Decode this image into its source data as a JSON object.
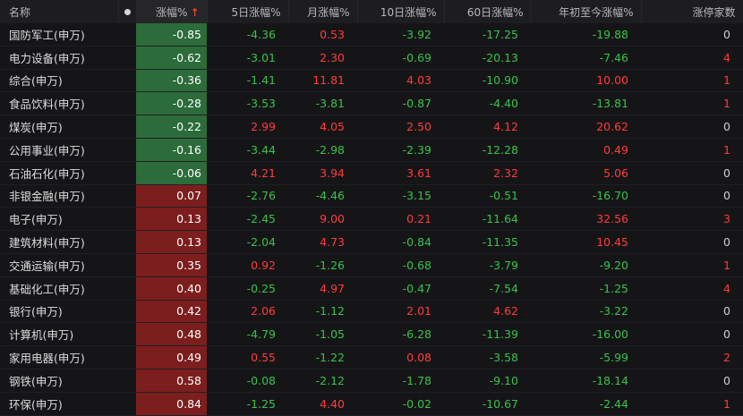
{
  "headers": {
    "name": "名称",
    "change": "涨幅%",
    "sort_arrow": "↑",
    "chg5": "5日涨幅%",
    "chg_month": "月涨幅%",
    "chg10": "10日涨幅%",
    "chg60": "60日涨幅%",
    "chg_ytd": "年初至今涨幅%",
    "limit_up": "涨停家数"
  },
  "colors": {
    "up": "#ff3b3b",
    "down": "#39c24a",
    "bg_up": "#7d1e1e",
    "bg_down": "#2c6b3a"
  },
  "rows": [
    {
      "name": "国防军工(申万)",
      "change": "-0.85",
      "chg5": "-4.36",
      "chg_month": "0.53",
      "chg10": "-3.92",
      "chg60": "-17.25",
      "chg_ytd": "-19.88",
      "limit_up": "0"
    },
    {
      "name": "电力设备(申万)",
      "change": "-0.62",
      "chg5": "-3.01",
      "chg_month": "2.30",
      "chg10": "-0.69",
      "chg60": "-20.13",
      "chg_ytd": "-7.46",
      "limit_up": "4"
    },
    {
      "name": "综合(申万)",
      "change": "-0.36",
      "chg5": "-1.41",
      "chg_month": "11.81",
      "chg10": "4.03",
      "chg60": "-10.90",
      "chg_ytd": "10.00",
      "limit_up": "1"
    },
    {
      "name": "食品饮料(申万)",
      "change": "-0.28",
      "chg5": "-3.53",
      "chg_month": "-3.81",
      "chg10": "-0.87",
      "chg60": "-4.40",
      "chg_ytd": "-13.81",
      "limit_up": "1"
    },
    {
      "name": "煤炭(申万)",
      "change": "-0.22",
      "chg5": "2.99",
      "chg_month": "4.05",
      "chg10": "2.50",
      "chg60": "4.12",
      "chg_ytd": "20.62",
      "limit_up": "0"
    },
    {
      "name": "公用事业(申万)",
      "change": "-0.16",
      "chg5": "-3.44",
      "chg_month": "-2.98",
      "chg10": "-2.39",
      "chg60": "-12.28",
      "chg_ytd": "0.49",
      "limit_up": "1"
    },
    {
      "name": "石油石化(申万)",
      "change": "-0.06",
      "chg5": "4.21",
      "chg_month": "3.94",
      "chg10": "3.61",
      "chg60": "2.32",
      "chg_ytd": "5.06",
      "limit_up": "0"
    },
    {
      "name": "非银金融(申万)",
      "change": "0.07",
      "chg5": "-2.76",
      "chg_month": "-4.46",
      "chg10": "-3.15",
      "chg60": "-0.51",
      "chg_ytd": "-16.70",
      "limit_up": "0"
    },
    {
      "name": "电子(申万)",
      "change": "0.13",
      "chg5": "-2.45",
      "chg_month": "9.00",
      "chg10": "0.21",
      "chg60": "-11.64",
      "chg_ytd": "32.56",
      "limit_up": "3"
    },
    {
      "name": "建筑材料(申万)",
      "change": "0.13",
      "chg5": "-2.04",
      "chg_month": "4.73",
      "chg10": "-0.84",
      "chg60": "-11.35",
      "chg_ytd": "10.45",
      "limit_up": "0"
    },
    {
      "name": "交通运输(申万)",
      "change": "0.35",
      "chg5": "0.92",
      "chg_month": "-1.26",
      "chg10": "-0.68",
      "chg60": "-3.79",
      "chg_ytd": "-9.20",
      "limit_up": "1"
    },
    {
      "name": "基础化工(申万)",
      "change": "0.40",
      "chg5": "-0.25",
      "chg_month": "4.97",
      "chg10": "-0.47",
      "chg60": "-7.54",
      "chg_ytd": "-1.25",
      "limit_up": "4"
    },
    {
      "name": "银行(申万)",
      "change": "0.42",
      "chg5": "2.06",
      "chg_month": "-1.12",
      "chg10": "2.01",
      "chg60": "4.62",
      "chg_ytd": "-3.22",
      "limit_up": "0"
    },
    {
      "name": "计算机(申万)",
      "change": "0.48",
      "chg5": "-4.79",
      "chg_month": "-1.05",
      "chg10": "-6.28",
      "chg60": "-11.39",
      "chg_ytd": "-16.00",
      "limit_up": "0"
    },
    {
      "name": "家用电器(申万)",
      "change": "0.49",
      "chg5": "0.55",
      "chg_month": "-1.22",
      "chg10": "0.08",
      "chg60": "-3.58",
      "chg_ytd": "-5.99",
      "limit_up": "2"
    },
    {
      "name": "钢铁(申万)",
      "change": "0.58",
      "chg5": "-0.08",
      "chg_month": "-2.12",
      "chg10": "-1.78",
      "chg60": "-9.10",
      "chg_ytd": "-18.14",
      "limit_up": "0"
    },
    {
      "name": "环保(申万)",
      "change": "0.84",
      "chg5": "-1.25",
      "chg_month": "4.40",
      "chg10": "-0.02",
      "chg60": "-10.67",
      "chg_ytd": "-2.44",
      "limit_up": "1"
    }
  ]
}
